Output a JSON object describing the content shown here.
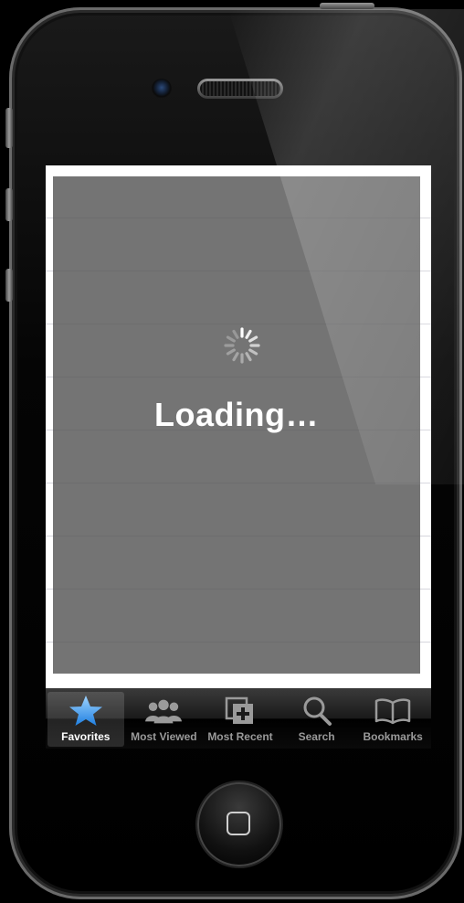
{
  "screen": {
    "loading_text": "Loading…"
  },
  "tabbar": {
    "active_index": 0,
    "accent_color": "#3aa0ff",
    "tabs": [
      {
        "label": "Favorites",
        "icon": "star-icon"
      },
      {
        "label": "Most Viewed",
        "icon": "people-icon"
      },
      {
        "label": "Most Recent",
        "icon": "clock-icon"
      },
      {
        "label": "Search",
        "icon": "search-icon"
      },
      {
        "label": "Bookmarks",
        "icon": "book-icon"
      }
    ]
  }
}
